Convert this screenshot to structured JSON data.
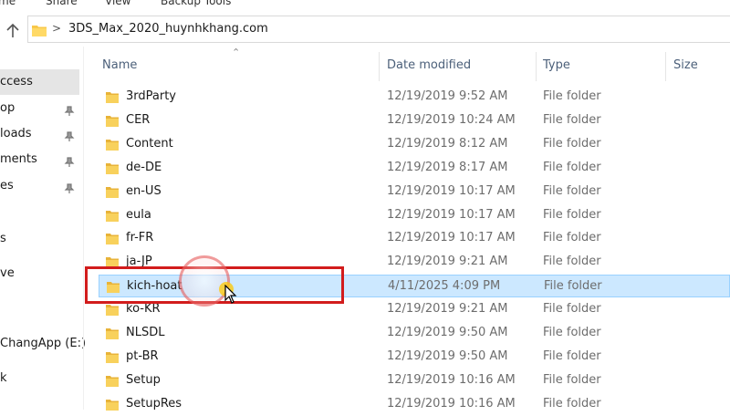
{
  "ribbon": {
    "tabs": [
      "me",
      "Share",
      "View",
      "Backup Tools"
    ]
  },
  "address_bar": {
    "chevron": ">",
    "path": "3DS_Max_2020_huynhkhang.com"
  },
  "nav_pane": {
    "items": [
      {
        "label": "ccess",
        "selected": true,
        "pinned": false
      },
      {
        "label": "op",
        "selected": false,
        "pinned": true
      },
      {
        "label": "loads",
        "selected": false,
        "pinned": true
      },
      {
        "label": "ments",
        "selected": false,
        "pinned": true
      },
      {
        "label": "es",
        "selected": false,
        "pinned": true
      },
      {
        "label": "s",
        "selected": false,
        "pinned": false
      },
      {
        "label": "ve",
        "selected": false,
        "pinned": false
      },
      {
        "label": "ChangApp (E:)",
        "selected": false,
        "pinned": false
      },
      {
        "label": "k",
        "selected": false,
        "pinned": false
      }
    ]
  },
  "columns": {
    "name": "Name",
    "date": "Date modified",
    "type": "Type",
    "size": "Size"
  },
  "files": [
    {
      "name": "3rdParty",
      "date": "12/19/2019 9:52 AM",
      "type": "File folder",
      "selected": false
    },
    {
      "name": "CER",
      "date": "12/19/2019 10:24 AM",
      "type": "File folder",
      "selected": false
    },
    {
      "name": "Content",
      "date": "12/19/2019 8:12 AM",
      "type": "File folder",
      "selected": false
    },
    {
      "name": "de-DE",
      "date": "12/19/2019 8:17 AM",
      "type": "File folder",
      "selected": false
    },
    {
      "name": "en-US",
      "date": "12/19/2019 10:17 AM",
      "type": "File folder",
      "selected": false
    },
    {
      "name": "eula",
      "date": "12/19/2019 10:17 AM",
      "type": "File folder",
      "selected": false
    },
    {
      "name": "fr-FR",
      "date": "12/19/2019 10:17 AM",
      "type": "File folder",
      "selected": false
    },
    {
      "name": "ja-JP",
      "date": "12/19/2019 9:21 AM",
      "type": "File folder",
      "selected": false
    },
    {
      "name": "kich-hoat",
      "date": "4/11/2025 4:09 PM",
      "type": "File folder",
      "selected": true
    },
    {
      "name": "ko-KR",
      "date": "12/19/2019 9:21 AM",
      "type": "File folder",
      "selected": false
    },
    {
      "name": "NLSDL",
      "date": "12/19/2019 9:50 AM",
      "type": "File folder",
      "selected": false
    },
    {
      "name": "pt-BR",
      "date": "12/19/2019 9:50 AM",
      "type": "File folder",
      "selected": false
    },
    {
      "name": "Setup",
      "date": "12/19/2019 10:16 AM",
      "type": "File folder",
      "selected": false
    },
    {
      "name": "SetupRes",
      "date": "12/19/2019 10:16 AM",
      "type": "File folder",
      "selected": false
    }
  ],
  "colors": {
    "selection_bg": "#cce8ff",
    "selection_border": "#99d1ff",
    "highlight_box": "#d21c1c",
    "folder_yellow": "#f8c84a"
  }
}
